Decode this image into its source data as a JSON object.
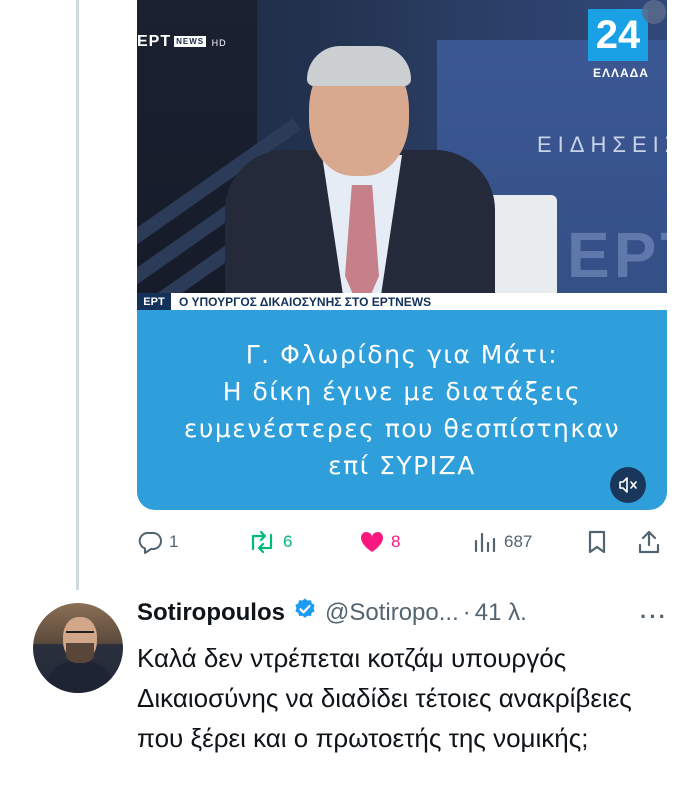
{
  "media": {
    "channel_logo": "ΕΡΤ",
    "channel_sub": "NEWS",
    "channel_hd": "HD",
    "corner_badge": "24",
    "corner_label": "ΕΛΛΑΔΑ",
    "backdrop_text": "ΕΙΔΗΣΕΙΣ",
    "backdrop_logo": "ΕΡΤ N",
    "lower_third_tag": "ΕΡΤ",
    "lower_third_text": "Ο ΥΠΟΥΡΓΟΣ ΔΙΚΑΙΟΣΥΝΗΣ ΣΤΟ ΕΡΤNEWS",
    "caption_lines": [
      "Γ. Φλωρίδης για Μάτι:",
      "Η δίκη έγινε με διατάξεις",
      "ευμενέστερες που θεσπίστηκαν",
      "επί ΣΥΡΙΖΑ"
    ],
    "mute_icon": "speaker-muted-icon",
    "caption_bg": "#2f9fdb"
  },
  "actions": {
    "replies": "1",
    "reposts": "6",
    "likes": "8",
    "views": "687",
    "repost_color": "#00ba7c",
    "like_color": "#f91880"
  },
  "reply": {
    "name": "Sotiropoulos",
    "handle": "@Sotiropo...",
    "separator": "·",
    "time": "41 λ.",
    "more": "···",
    "text": "Καλά δεν ντρέπεται κοτζάμ υπουργός Δικαιοσύνης να διαδίδει τέτοιες ανακρίβειες που ξέρει και ο πρωτοετής της νομικής;",
    "verified_color": "#1d9bf0"
  }
}
